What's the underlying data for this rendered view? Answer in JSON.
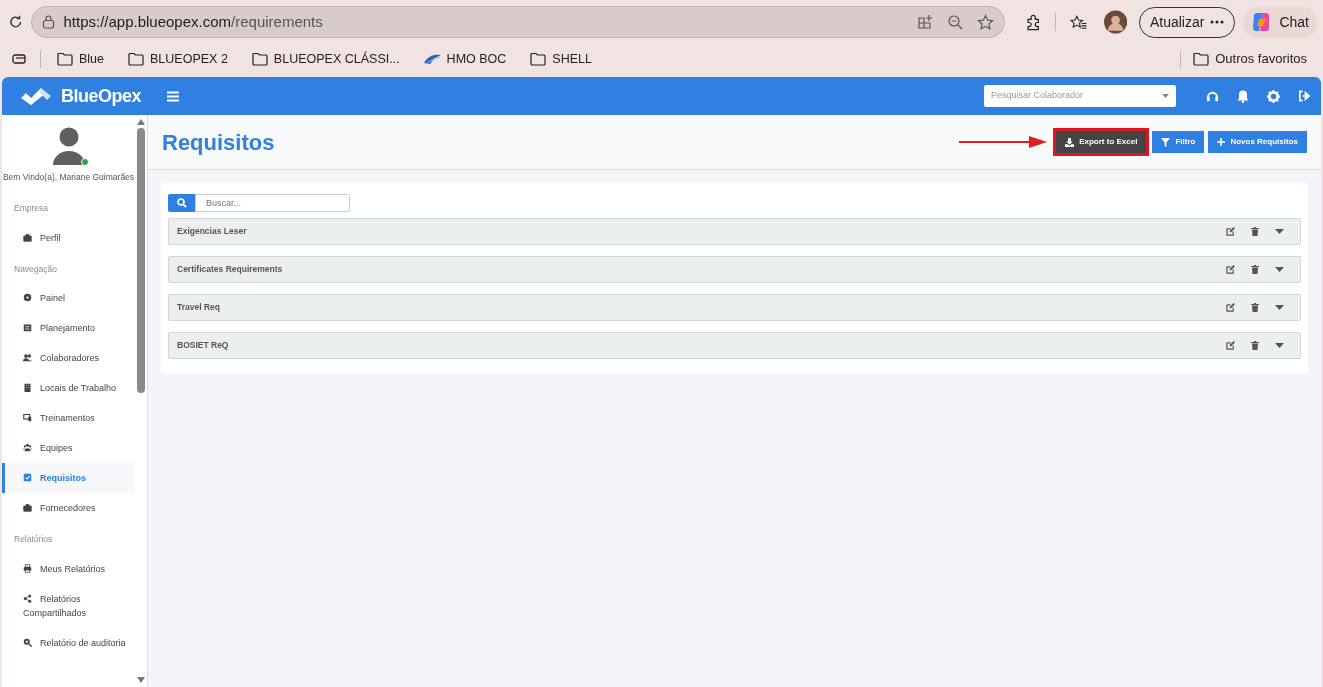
{
  "browser": {
    "url_host": "https://app.blueopex.com",
    "url_path": "/requirements",
    "update_button": "Atualizar",
    "chat_button": "Chat",
    "bookmarks": [
      {
        "label": "Blue",
        "kind": "folder"
      },
      {
        "label": "BLUEOPEX 2",
        "kind": "folder"
      },
      {
        "label": "BLUEOPEX CLÁSSI...",
        "kind": "folder"
      },
      {
        "label": "HMO BOC",
        "kind": "site"
      },
      {
        "label": "SHELL",
        "kind": "folder"
      }
    ],
    "other_bookmarks": "Outros favoritos"
  },
  "app": {
    "logo": "BlueOpex",
    "search": {
      "placeholder": "Pesquisar Colaborador"
    }
  },
  "sidebar": {
    "welcome": "Bem Vindo(a), Mariane Guimarães",
    "online": true,
    "sections": [
      {
        "title": "Empresa",
        "items": [
          {
            "label": "Perfil",
            "selected": false
          }
        ]
      },
      {
        "title": "Navegação",
        "items": [
          {
            "label": "Painel",
            "selected": false
          },
          {
            "label": "Planejamento",
            "selected": false
          },
          {
            "label": "Colaboradores",
            "selected": false
          },
          {
            "label": "Locais de Trabalho",
            "selected": false
          },
          {
            "label": "Treinamentos",
            "selected": false
          },
          {
            "label": "Equipes",
            "selected": false
          },
          {
            "label": "Requisitos",
            "selected": true
          },
          {
            "label": "Fornecedores",
            "selected": false
          }
        ]
      },
      {
        "title": "Relatórios",
        "items": [
          {
            "label": "Meus Relatórios",
            "selected": false
          },
          {
            "label": "Relatórios Compartilhados",
            "selected": false
          },
          {
            "label": "Relatório de auditoria",
            "selected": false
          }
        ]
      }
    ]
  },
  "page": {
    "title": "Requisitos",
    "actions": [
      {
        "label": "Export to Excel",
        "kind": "export",
        "highlighted": true
      },
      {
        "label": "Filtro",
        "kind": "filter",
        "highlighted": false
      },
      {
        "label": "Novos Requisitos",
        "kind": "new",
        "highlighted": false
      }
    ],
    "search": {
      "placeholder": "Buscar..."
    },
    "requirements": [
      {
        "name": "Exigencias Leser"
      },
      {
        "name": "Certificates Requirements"
      },
      {
        "name": "Travel Req"
      },
      {
        "name": "BOSIET ReQ"
      }
    ]
  }
}
